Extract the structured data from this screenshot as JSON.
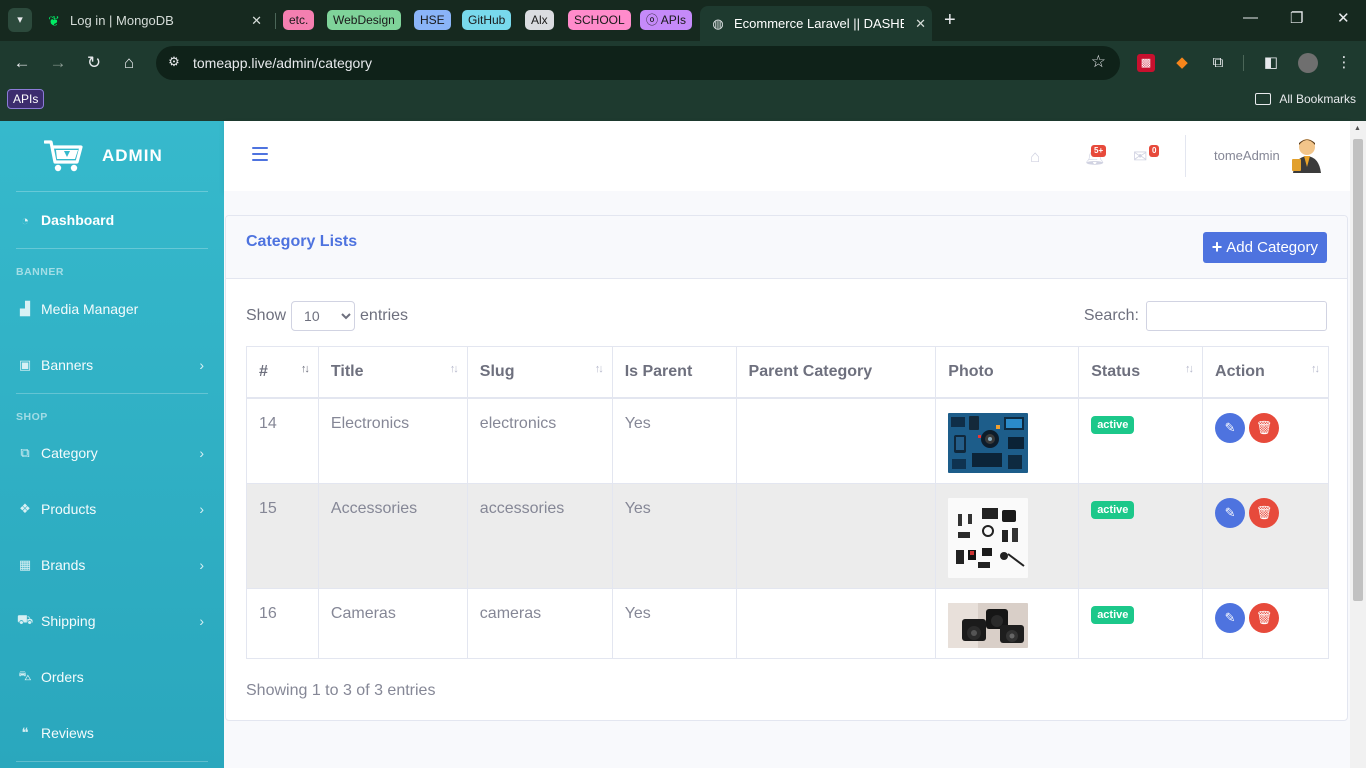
{
  "browser": {
    "tabs": [
      {
        "title": "Log in | MongoDB"
      },
      {
        "title": "Ecommerce Laravel || DASHBOA"
      }
    ],
    "tab_groups": [
      {
        "label": "etc.",
        "color": "#f47fb0"
      },
      {
        "label": "WebDesign",
        "color": "#7fd39a"
      },
      {
        "label": "HSE",
        "color": "#8ab4f8"
      },
      {
        "label": "GitHub",
        "color": "#78d9ec"
      },
      {
        "label": "Alx",
        "color": "#dadce0"
      },
      {
        "label": "SCHOOL",
        "color": "#ff8bcb"
      },
      {
        "label": "APIs",
        "color": "#c58af9"
      }
    ],
    "url": "tomeapp.live/admin/category",
    "bookmark_apis": "APIs",
    "all_bookmarks": "All Bookmarks"
  },
  "sidebar": {
    "brand": "ADMIN",
    "dashboard": "Dashboard",
    "heading_banner": "BANNER",
    "media_manager": "Media Manager",
    "banners": "Banners",
    "heading_shop": "SHOP",
    "category": "Category",
    "products": "Products",
    "brands": "Brands",
    "shipping": "Shipping",
    "orders": "Orders",
    "reviews": "Reviews"
  },
  "topbar": {
    "notifications_count": "5+",
    "messages_count": "0",
    "user_name": "tomeAdmin"
  },
  "page": {
    "title": "Category Lists",
    "add_button": "Add Category",
    "show_label": "Show",
    "entries_label": "entries",
    "entries_value": "10",
    "search_label": "Search:",
    "search_value": "",
    "info": "Showing 1 to 3 of 3 entries"
  },
  "table": {
    "columns": [
      "#",
      "Title",
      "Slug",
      "Is Parent",
      "Parent Category",
      "Photo",
      "Status",
      "Action"
    ],
    "rows": [
      {
        "id": "14",
        "title": "Electronics",
        "slug": "electronics",
        "is_parent": "Yes",
        "parent": "",
        "photo": "electronics-photo",
        "status": "active"
      },
      {
        "id": "15",
        "title": "Accessories",
        "slug": "accessories",
        "is_parent": "Yes",
        "parent": "",
        "photo": "accessories-photo",
        "status": "active"
      },
      {
        "id": "16",
        "title": "Cameras",
        "slug": "cameras",
        "is_parent": "Yes",
        "parent": "",
        "photo": "cameras-photo",
        "status": "active"
      }
    ]
  },
  "colors": {
    "primary": "#4e73df",
    "sidebar": "#36b9cc",
    "success": "#1cc88a",
    "danger": "#e74a3b"
  }
}
